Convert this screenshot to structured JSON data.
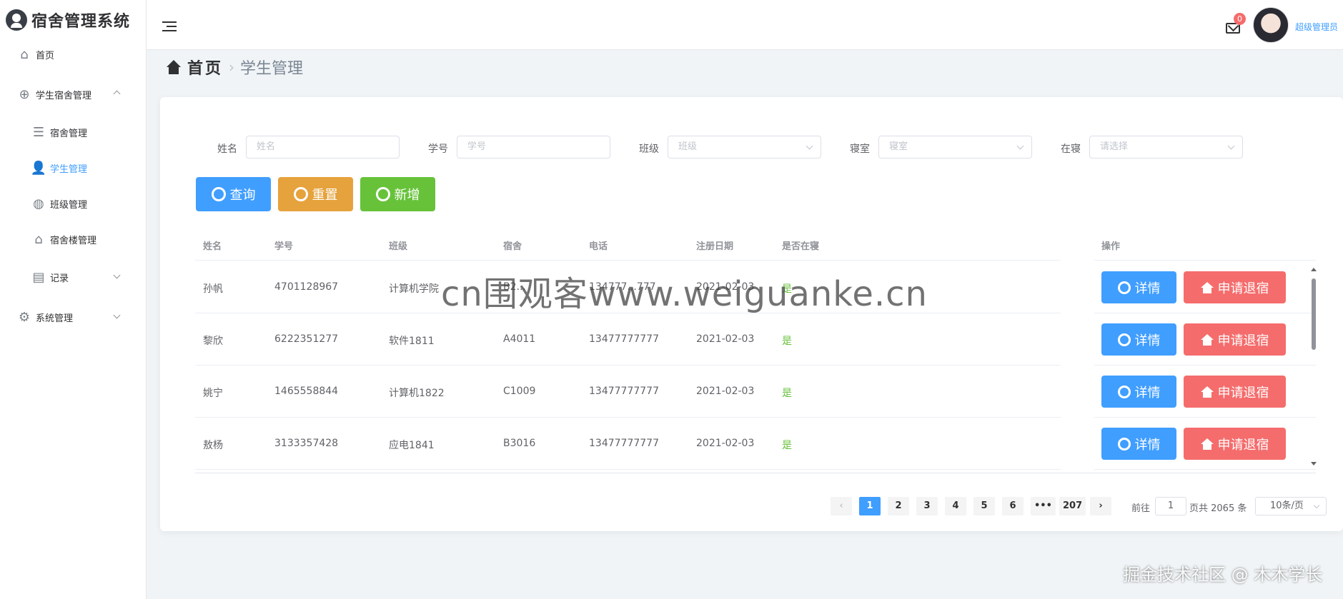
{
  "brand": {
    "name": "宿舍管理系统"
  },
  "sidebar": {
    "items": [
      {
        "label": "首页",
        "icon": "home-icon"
      },
      {
        "label": "学生宿舍管理",
        "icon": "group-icon"
      },
      {
        "label": "宿舍管理",
        "icon": "list-icon"
      },
      {
        "label": "学生管理",
        "icon": "user-add-icon"
      },
      {
        "label": "班级管理",
        "icon": "drop-icon"
      },
      {
        "label": "宿舍楼管理",
        "icon": "building-icon"
      },
      {
        "label": "记录",
        "icon": "document-icon"
      },
      {
        "label": "系统管理",
        "icon": "gear-icon"
      }
    ],
    "active": "学生管理"
  },
  "header": {
    "mail_badge": "0",
    "admin_name": "超级管理员"
  },
  "breadcrumb": {
    "home": "首页",
    "current": "学生管理"
  },
  "filters": [
    {
      "label": "姓名",
      "placeholder": "姓名"
    },
    {
      "label": "学号",
      "placeholder": "学号"
    },
    {
      "label": "班级",
      "placeholder": "班级"
    },
    {
      "label": "寝室",
      "placeholder": "寝室"
    },
    {
      "label": "在寝",
      "placeholder": "请选择"
    }
  ],
  "buttons": {
    "query": "查询",
    "reset": "重置",
    "add": "新增"
  },
  "table": {
    "columns": [
      "姓名",
      "学号",
      "班级",
      "宿舍",
      "电话",
      "注册日期",
      "是否在寝",
      "操作"
    ],
    "rows": [
      {
        "name": "孙帆",
        "id": "4701128967",
        "class": "计算机学院",
        "dorm": "B2...",
        "phone": "134777...777",
        "date": "2021-02-03",
        "in": "是"
      },
      {
        "name": "黎欣",
        "id": "6222351277",
        "class": "软件1811",
        "dorm": "A4011",
        "phone": "13477777777",
        "date": "2021-02-03",
        "in": "是"
      },
      {
        "name": "姚宁",
        "id": "1465558844",
        "class": "计算机1822",
        "dorm": "C1009",
        "phone": "13477777777",
        "date": "2021-02-03",
        "in": "是"
      },
      {
        "name": "敖杨",
        "id": "3133357428",
        "class": "应电1841",
        "dorm": "B3016",
        "phone": "13477777777",
        "date": "2021-02-03",
        "in": "是"
      }
    ],
    "detail_label": "详情",
    "leave_label": "申请退宿"
  },
  "pagination": {
    "pages": [
      "1",
      "2",
      "3",
      "4",
      "5",
      "6",
      "•••",
      "207"
    ],
    "current": "1",
    "goto_prefix": "前往",
    "goto_value": "1",
    "goto_suffix": "页共 2065 条",
    "page_size": "10条/页"
  },
  "watermark": "cn围观客www.weiguanke.cn",
  "footer_mark": "掘金技术社区 @ 木木学长",
  "colors": {
    "primary": "#409eff",
    "warning": "#e6a23c",
    "success": "#67c23a",
    "danger": "#f56c6c"
  }
}
